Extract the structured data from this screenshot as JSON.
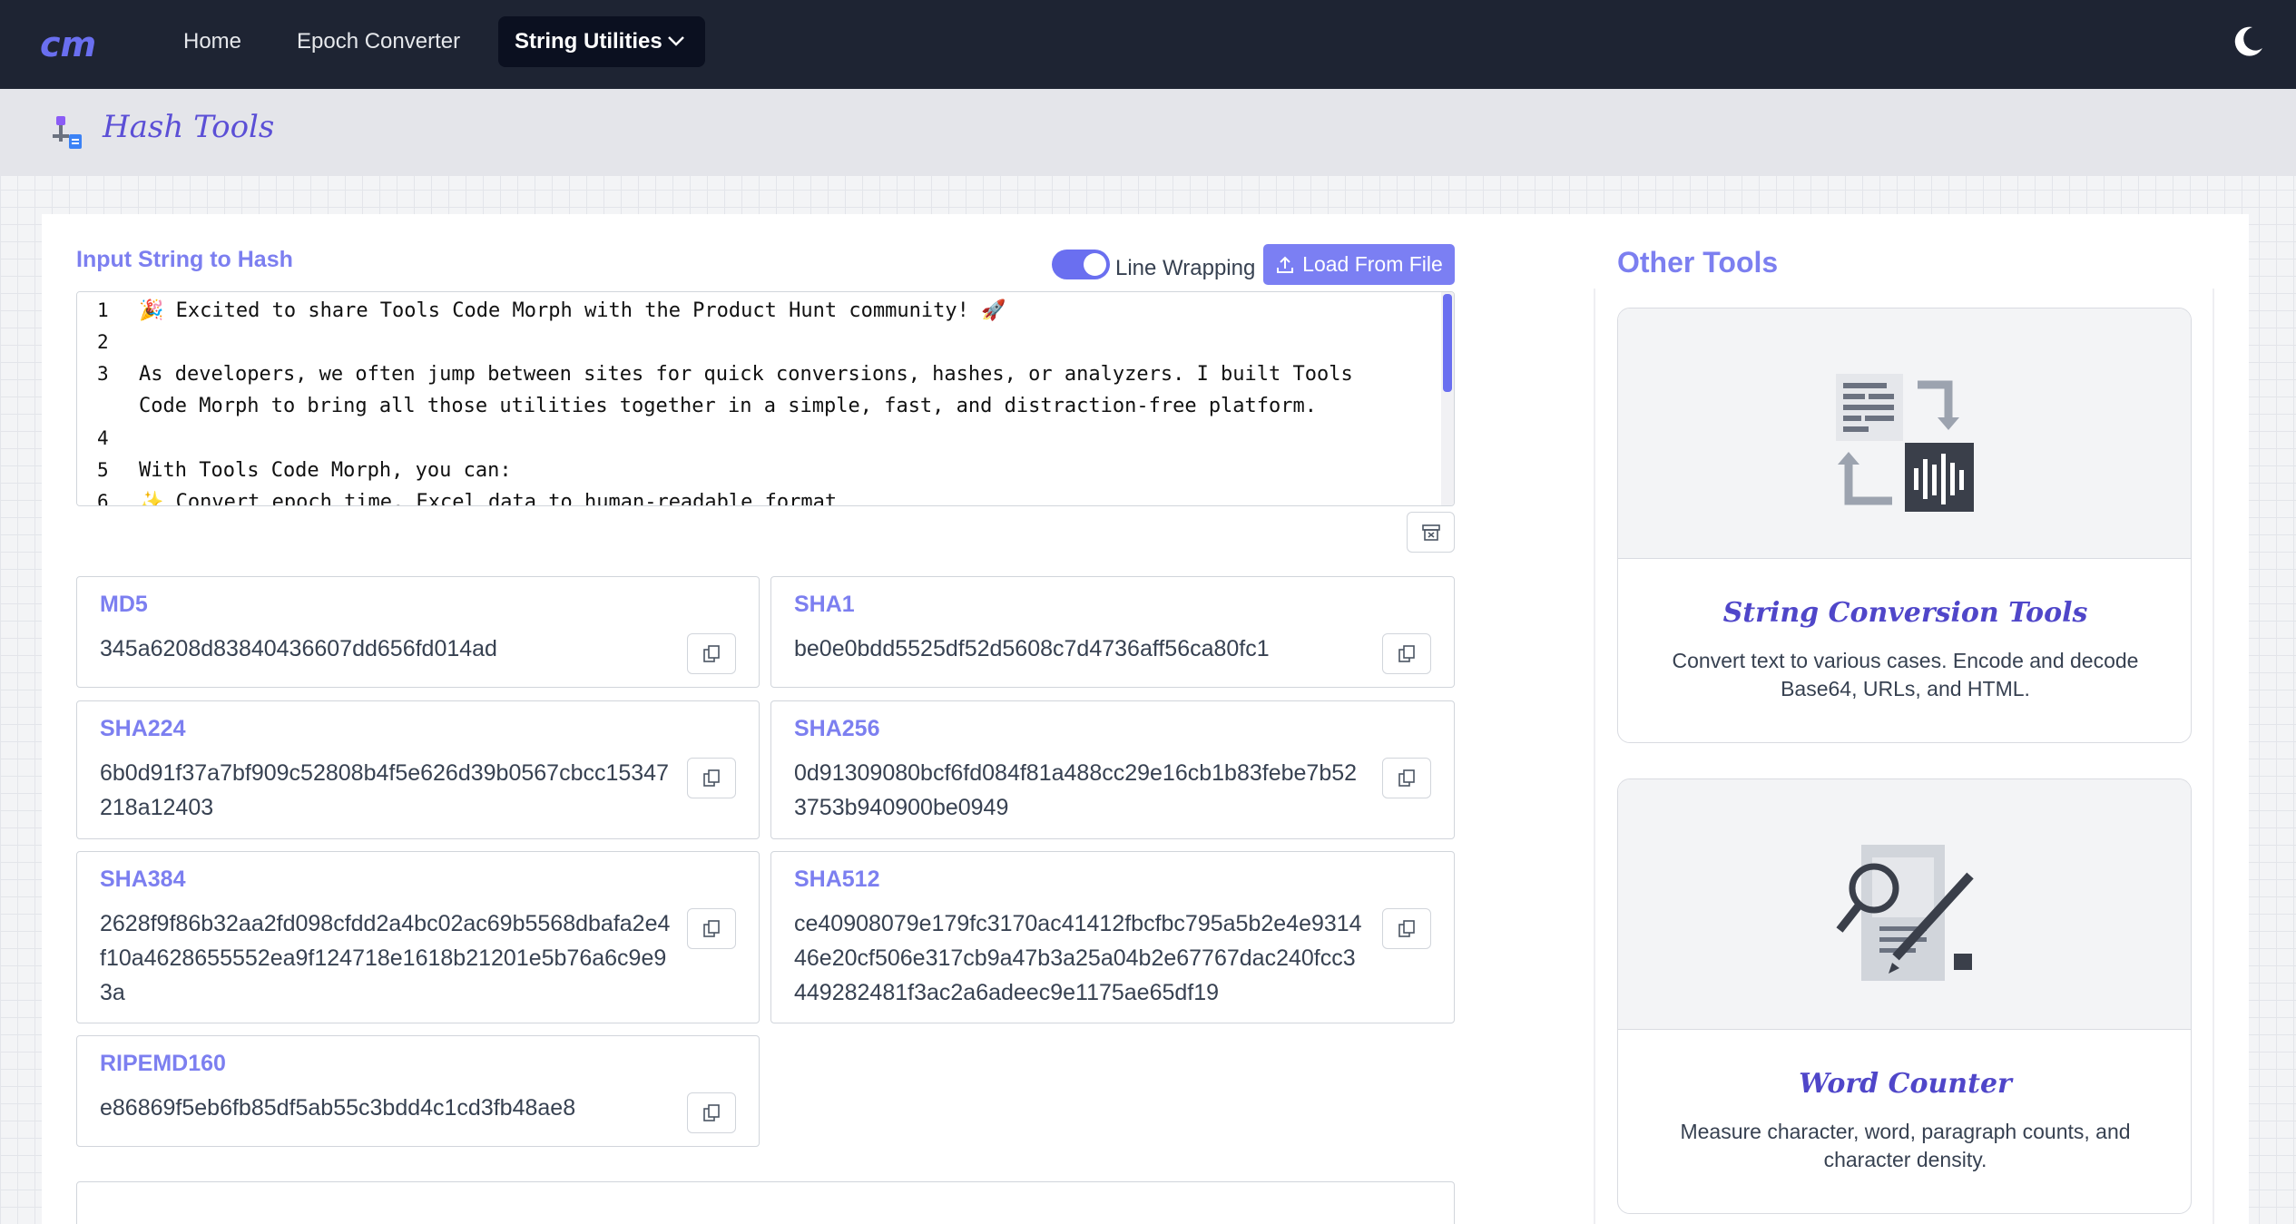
{
  "nav": {
    "logo": "CM",
    "home": "Home",
    "epoch": "Epoch Converter",
    "string_utilities": "String Utilities"
  },
  "header": {
    "title": "Hash Tools"
  },
  "input": {
    "label": "Input String to Hash",
    "line_wrapping_label": "Line Wrapping",
    "line_wrapping_on": true,
    "load_button": "Load From File",
    "line_numbers": [
      "1",
      "2",
      "3",
      "4",
      "5",
      "6"
    ],
    "lines": [
      "🎉 Excited to share Tools Code Morph with the Product Hunt community! 🚀",
      "",
      "As developers, we often jump between sites for quick conversions, hashes, or analyzers. I built Tools",
      "Code Morph to bring all those utilities together in a simple, fast, and distraction-free platform.",
      "",
      "With Tools Code Morph, you can:",
      "✨ Convert epoch time, Excel data to human-readable format"
    ]
  },
  "hashes": [
    {
      "name": "MD5",
      "value": "345a6208d83840436607dd656fd014ad"
    },
    {
      "name": "SHA1",
      "value": "be0e0bdd5525df52d5608c7d4736aff56ca80fc1"
    },
    {
      "name": "SHA224",
      "value": "6b0d91f37a7bf909c52808b4f5e626d39b0567cbcc15347218a12403"
    },
    {
      "name": "SHA256",
      "value": "0d91309080bcf6fd084f81a488cc29e16cb1b83febe7b523753b940900be0949"
    },
    {
      "name": "SHA384",
      "value": "2628f9f86b32aa2fd098cfdd2a4bc02ac69b5568dbafa2e4f10a4628655552ea9f124718e1618b21201e5b76a6c9e93a"
    },
    {
      "name": "SHA512",
      "value": "ce40908079e179fc3170ac41412fbcfbc795a5b2e4e931446e20cf506e317cb9a47b3a25a04b2e67767dac240fcc3449282481f3ac2a6adeec9e1175ae65df19"
    },
    {
      "name": "RIPEMD160",
      "value": "e86869f5eb6fb85df5ab55c3bdd4c1cd3fb48ae8"
    }
  ],
  "other_tools": {
    "title": "Other Tools",
    "cards": [
      {
        "title": "String Conversion Tools",
        "description": "Convert text to various cases. Encode and decode Base64, URLs, and HTML.",
        "icon": "text-conversion-icon"
      },
      {
        "title": "Word Counter",
        "description": "Measure character, word, paragraph counts, and character density.",
        "icon": "document-magnifier-icon"
      }
    ]
  },
  "colors": {
    "navbar": "#1e2433",
    "accent": "#7c7ff0",
    "title_serif": "#5b4fd6"
  }
}
